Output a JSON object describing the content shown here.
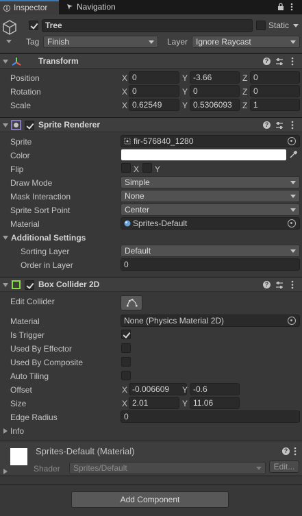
{
  "tabs": [
    {
      "label": "Inspector"
    },
    {
      "label": "Navigation"
    }
  ],
  "object": {
    "name": "Tree",
    "static_label": "Static",
    "tag_label": "Tag",
    "tag_value": "Finish",
    "layer_label": "Layer",
    "layer_value": "Ignore Raycast"
  },
  "transform": {
    "title": "Transform",
    "position": {
      "label": "Position",
      "x": "0",
      "y": "-3.66",
      "z": "0"
    },
    "rotation": {
      "label": "Rotation",
      "x": "0",
      "y": "0",
      "z": "0"
    },
    "scale": {
      "label": "Scale",
      "x": "0.62549",
      "y": "0.5306093",
      "z": "1"
    }
  },
  "axes": {
    "x": "X",
    "y": "Y",
    "z": "Z"
  },
  "sprite_renderer": {
    "title": "Sprite Renderer",
    "sprite_label": "Sprite",
    "sprite_value": "fir-576840_1280",
    "color_label": "Color",
    "color_value": "#ffffff",
    "flip_label": "Flip",
    "flip_x": "X",
    "flip_y": "Y",
    "draw_mode_label": "Draw Mode",
    "draw_mode_value": "Simple",
    "mask_label": "Mask Interaction",
    "mask_value": "None",
    "sort_point_label": "Sprite Sort Point",
    "sort_point_value": "Center",
    "material_label": "Material",
    "material_value": "Sprites-Default",
    "additional_label": "Additional Settings",
    "sorting_layer_label": "Sorting Layer",
    "sorting_layer_value": "Default",
    "order_label": "Order in Layer",
    "order_value": "0"
  },
  "box_collider": {
    "title": "Box Collider 2D",
    "edit_label": "Edit Collider",
    "material_label": "Material",
    "material_value": "None (Physics Material 2D)",
    "trigger_label": "Is Trigger",
    "effector_label": "Used By Effector",
    "composite_label": "Used By Composite",
    "tiling_label": "Auto Tiling",
    "offset_label": "Offset",
    "offset_x": "-0.006609",
    "offset_y": "-0.6",
    "size_label": "Size",
    "size_x": "2.01",
    "size_y": "11.06",
    "radius_label": "Edge Radius",
    "radius_value": "0",
    "info_label": "Info"
  },
  "material_panel": {
    "name": "Sprites-Default (Material)",
    "shader_label": "Shader",
    "shader_value": "Sprites/Default",
    "edit_label": "Edit..."
  },
  "add_component_label": "Add Component"
}
